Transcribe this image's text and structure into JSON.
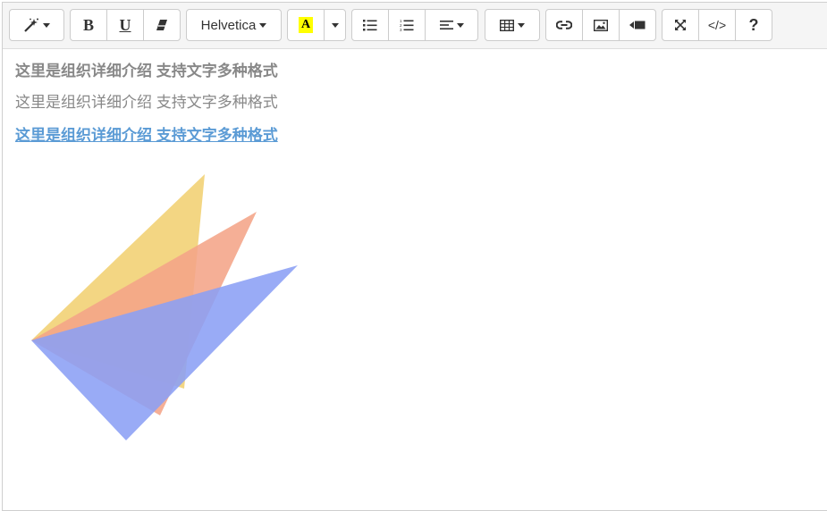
{
  "toolbar": {
    "style_icon": "magic-wand-icon",
    "bold_label": "B",
    "underline_label": "U",
    "eraser_icon": "eraser-icon",
    "font_family_value": "Helvetica",
    "color_label": "A",
    "unordered_list_icon": "unordered-list-icon",
    "ordered_list_icon": "ordered-list-icon",
    "align_icon": "align-left-icon",
    "table_icon": "table-icon",
    "link_icon": "link-icon",
    "picture_icon": "picture-icon",
    "video_icon": "video-icon",
    "fullscreen_icon": "fullscreen-icon",
    "codeview_label": "</>",
    "help_label": "?"
  },
  "content": {
    "line1": "这里是组织详细介绍 支持文字多种格式",
    "line2": "这里是组织详细介绍 支持文字多种格式",
    "line3": "这里是组织详细介绍 支持文字多种格式"
  },
  "colors": {
    "highlight": "#ffff00",
    "link": "#5b9bd5",
    "logo_yellow": "#f2d275",
    "logo_orange": "#f4a487",
    "logo_blue": "#8b9ff5"
  }
}
